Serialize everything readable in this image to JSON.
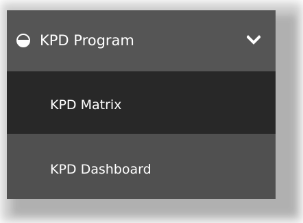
{
  "menu": {
    "header": {
      "label": "KPD Program",
      "icon": "half-circle-icon",
      "toggle_icon": "chevron-down-icon",
      "expanded": true
    },
    "items": [
      {
        "label": "KPD Matrix",
        "active": true
      },
      {
        "label": "KPD Dashboard",
        "active": false
      }
    ]
  },
  "colors": {
    "header_bg": "#555555",
    "active_item_bg": "#282828",
    "item_bg": "#505050",
    "text": "#ffffff"
  }
}
